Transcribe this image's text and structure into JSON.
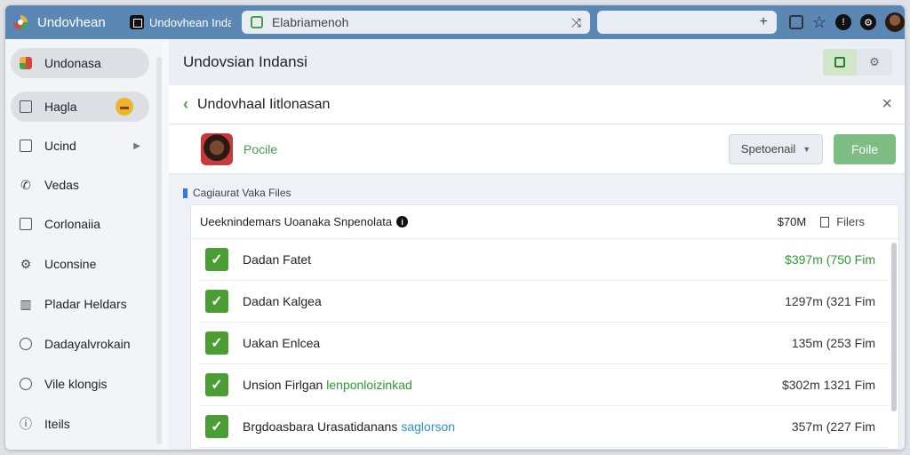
{
  "topbar": {
    "app_title": "Undovhean",
    "tab_title": "Undovhean Indansi",
    "url": "Elabriamenoh",
    "colors": {
      "topbar": "#5b87b4",
      "accent": "#43a047"
    }
  },
  "sidebar": {
    "items": [
      {
        "label": "Undonasa",
        "icon": "app-logo-icon"
      },
      {
        "label": "Hagla",
        "icon": "page-icon",
        "badge": ""
      },
      {
        "label": "Ucind",
        "icon": "list-icon"
      },
      {
        "label": "Vedas",
        "icon": "phone-icon"
      },
      {
        "label": "Corlonaiia",
        "icon": "document-icon"
      },
      {
        "label": "Uconsine",
        "icon": "settings-icon"
      },
      {
        "label": "Pladar Heldars",
        "icon": "folder-icon"
      },
      {
        "label": "Dadayalvrokain",
        "icon": "list-icon"
      },
      {
        "label": "Vile klongis",
        "icon": "globe-icon"
      },
      {
        "label": "Iteils",
        "icon": "info-icon"
      }
    ]
  },
  "header": {
    "title": "Undovsian Indansi"
  },
  "panel": {
    "title": "Undovhaal Iitlonasan",
    "profile_name": "Pocile",
    "dropdown_value": "Spetoenail",
    "primary_button": "Foile",
    "section_label": "Cagiaurat Vaka Files",
    "card_title": "Ueeknindemars Uoanaka Snpenolata",
    "card_total": "$70M",
    "card_files_label": "Filers",
    "rows": [
      {
        "name": "Dadan Fatet",
        "tag": "",
        "value": "$397m (750 Fim",
        "value_color": "#2e9a35",
        "tag_color": ""
      },
      {
        "name": "Dadan Kalgea",
        "tag": "",
        "value": "1297m (321 Fim",
        "value_color": "#333333",
        "tag_color": ""
      },
      {
        "name": "Uakan Enlcea",
        "tag": "",
        "value": "135m (253 Fim",
        "value_color": "#333333",
        "tag_color": ""
      },
      {
        "name": "Unsion Firlgan",
        "tag": "lenponloizinkad",
        "value": "$302m 1321 Fim",
        "value_color": "#333333",
        "tag_color": "#2e9a35"
      },
      {
        "name": "Brgdoasbara Urasatidanans",
        "tag": "saglorson",
        "value": "357m (227 Fim",
        "value_color": "#333333",
        "tag_color": "#2f8fc8"
      }
    ]
  }
}
